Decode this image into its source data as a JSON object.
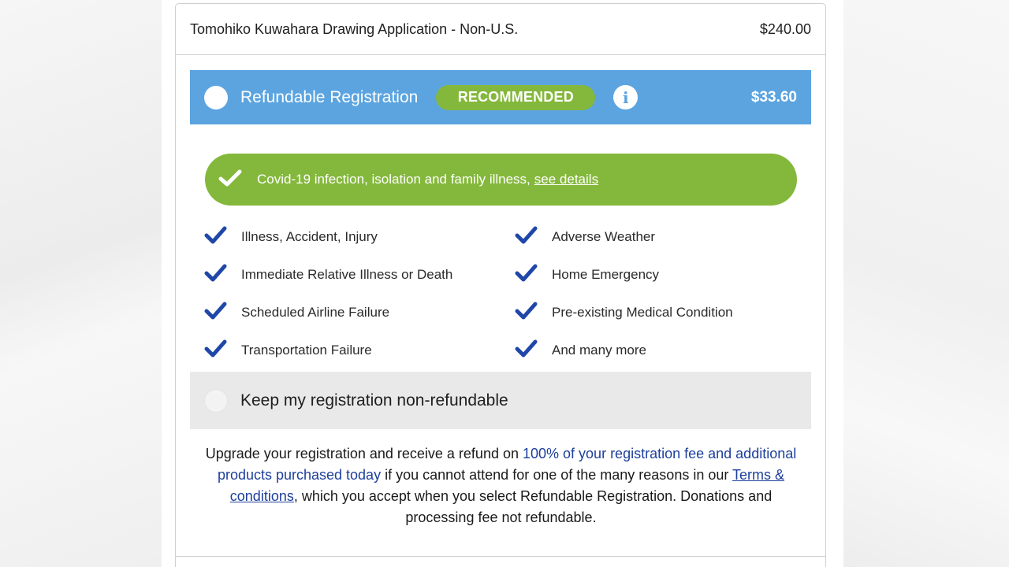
{
  "item": {
    "name": "Tomohiko Kuwahara Drawing Application - Non-U.S.",
    "price": "$240.00"
  },
  "refundable": {
    "title": "Refundable Registration",
    "badge": "RECOMMENDED",
    "info_icon": "info-icon",
    "price": "$33.60",
    "color": "#5ba4e0"
  },
  "covid": {
    "text": "Covid-19 infection, isolation and family illness,",
    "link": "see details",
    "color": "#84b83c"
  },
  "benefits": [
    "Illness, Accident, Injury",
    "Adverse Weather",
    "Immediate Relative Illness or Death",
    "Home Emergency",
    "Scheduled Airline Failure",
    "Pre-existing Medical Condition",
    "Transportation Failure",
    "And many more"
  ],
  "non_refundable": {
    "label": "Keep my registration non-refundable"
  },
  "terms": {
    "part1": "Upgrade your registration and receive a refund on ",
    "highlight": "100% of your registration fee and additional products purchased today",
    "part2": " if you cannot attend for one of the many reasons in our ",
    "link": "Terms & conditions",
    "part3": ", which you accept when you select Refundable Registration. Donations and processing fee not refundable."
  },
  "colors": {
    "check_blue": "#1f47a8",
    "link_blue": "#1d3f9c"
  }
}
